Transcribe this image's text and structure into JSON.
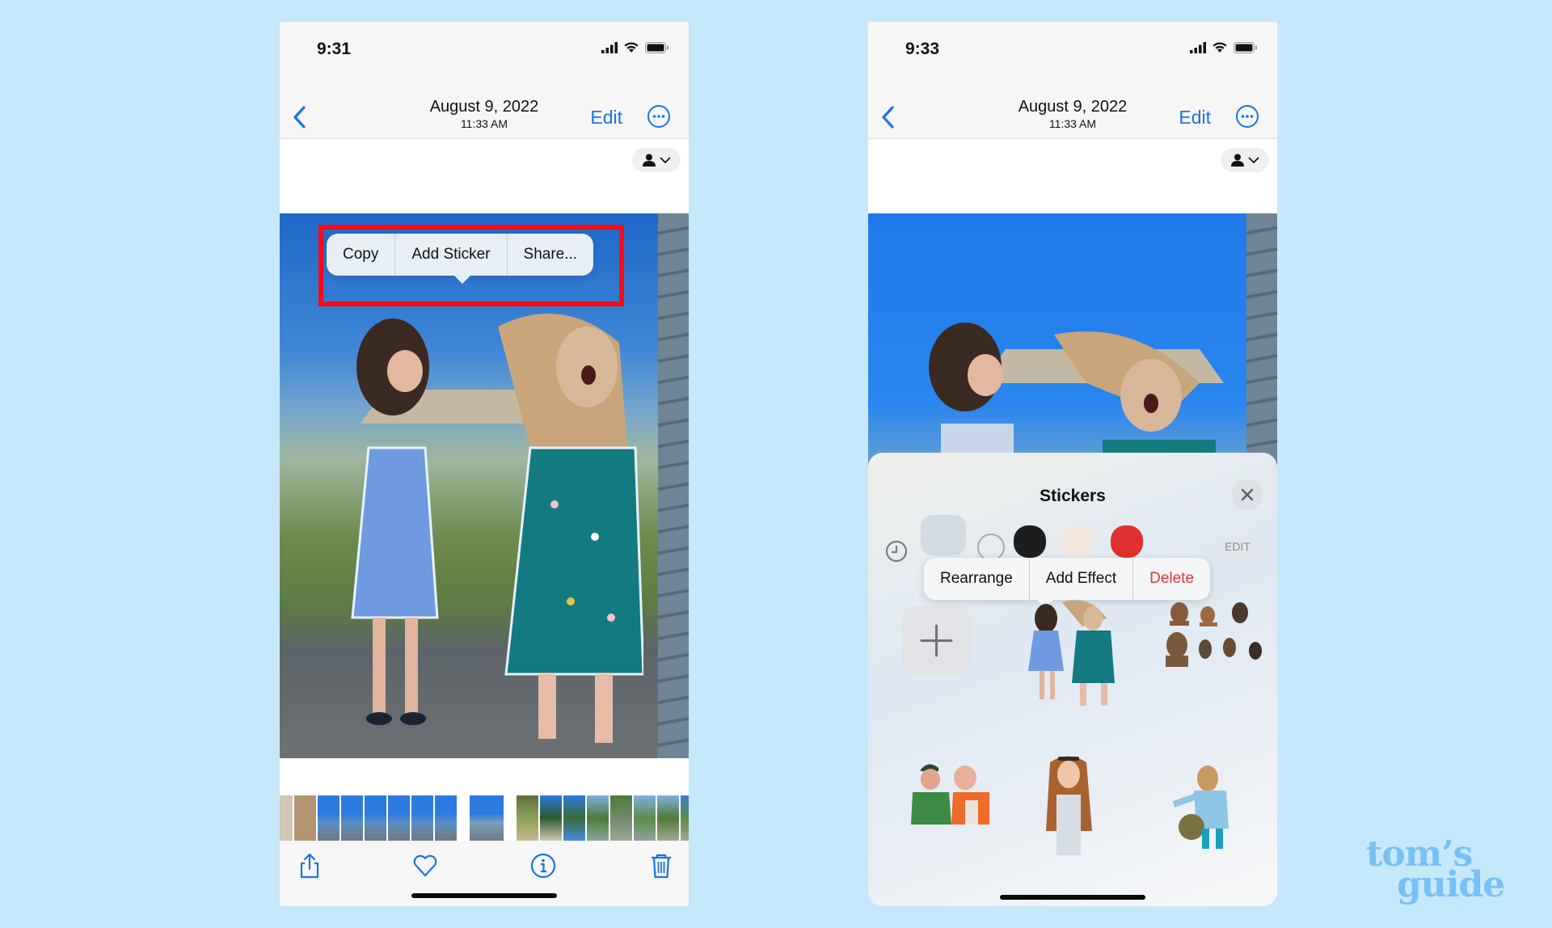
{
  "left": {
    "status": {
      "time": "9:31"
    },
    "nav": {
      "date": "August 9, 2022",
      "time": "11:33 AM",
      "edit_label": "Edit"
    },
    "context_menu": {
      "items": [
        "Copy",
        "Add Sticker",
        "Share..."
      ]
    },
    "toolbar": {
      "icons": [
        "share-icon",
        "heart-icon",
        "info-icon",
        "trash-icon"
      ]
    }
  },
  "right": {
    "status": {
      "time": "9:33"
    },
    "nav": {
      "date": "August 9, 2022",
      "time": "11:33 AM",
      "edit_label": "Edit"
    },
    "stickers": {
      "title": "Stickers",
      "edit_label": "EDIT",
      "context_menu": {
        "items": [
          "Rearrange",
          "Add Effect",
          "Delete"
        ]
      },
      "colors": {
        "delete": "#e53935"
      }
    }
  },
  "watermark": {
    "line1": "tom’s",
    "line2": "guide"
  },
  "colors": {
    "accent": "#1a73e8",
    "highlight": "#ff0a14",
    "background": "#c6e8fb"
  }
}
